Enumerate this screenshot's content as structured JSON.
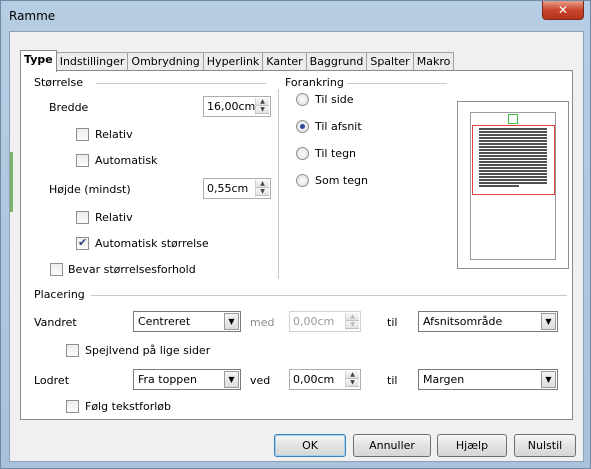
{
  "window": {
    "title": "Ramme",
    "close_glyph": "✕"
  },
  "tabs": [
    "Type",
    "Indstillinger",
    "Ombrydning",
    "Hyperlink",
    "Kanter",
    "Baggrund",
    "Spalter",
    "Makro"
  ],
  "size": {
    "group_label": "Størrelse",
    "width_label": "Bredde",
    "width_value": "16,00cm",
    "relative_label": "Relativ",
    "automatic_label": "Automatisk",
    "height_label": "Højde (mindst)",
    "height_value": "0,55cm",
    "height_relative_label": "Relativ",
    "auto_size_label": "Automatisk størrelse",
    "keep_ratio_label": "Bevar størrelsesforhold"
  },
  "anchor": {
    "group_label": "Forankring",
    "options": [
      "Til side",
      "Til afsnit",
      "Til tegn",
      "Som tegn"
    ],
    "selected": "Til afsnit"
  },
  "position": {
    "group_label": "Placering",
    "horizontal_label": "Vandret",
    "horizontal_value": "Centreret",
    "by_label": "med",
    "by_value": "0,00cm",
    "to_label": "til",
    "horizontal_to_value": "Afsnitsområde",
    "mirror_label": "Spejlvend på lige sider",
    "vertical_label": "Lodret",
    "vertical_value": "Fra toppen",
    "vertical_by_label": "ved",
    "vertical_by_value": "0,00cm",
    "vertical_to_label": "til",
    "vertical_to_value": "Margen",
    "follow_label": "Følg tekstforløb"
  },
  "buttons": {
    "ok": "OK",
    "cancel": "Annuller",
    "help": "Hjælp",
    "reset": "Nulstil"
  }
}
